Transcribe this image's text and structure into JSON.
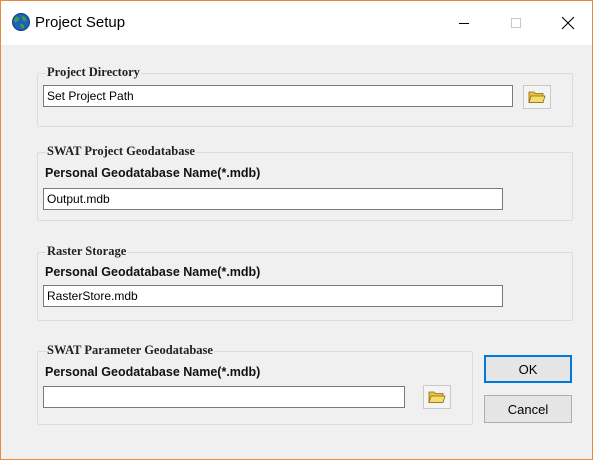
{
  "window": {
    "title": "Project Setup",
    "app_icon": "globe-icon",
    "controls": {
      "minimize": "minimize-icon",
      "maximize": "maximize-icon",
      "close": "close-icon"
    }
  },
  "project_directory": {
    "group_title": "Project Directory",
    "path_value": "Set Project Path",
    "browse_icon": "folder-open-icon"
  },
  "swat_project_geodatabase": {
    "group_title": "SWAT Project Geodatabase",
    "field_label": "Personal Geodatabase Name(*.mdb)",
    "value": "Output.mdb"
  },
  "raster_storage": {
    "group_title": "Raster Storage",
    "field_label": "Personal Geodatabase Name(*.mdb)",
    "value": "RasterStore.mdb"
  },
  "swat_parameter_geodatabase": {
    "group_title": "SWAT Parameter Geodatabase",
    "field_label": "Personal Geodatabase Name(*.mdb)",
    "value": "",
    "browse_icon": "folder-open-icon"
  },
  "buttons": {
    "ok_label": "OK",
    "cancel_label": "Cancel"
  },
  "colors": {
    "window_border": "#e88a3a",
    "dialog_background": "#f0f0f0",
    "default_button_border": "#0078d7",
    "folder_icon": "#f2d34a"
  }
}
